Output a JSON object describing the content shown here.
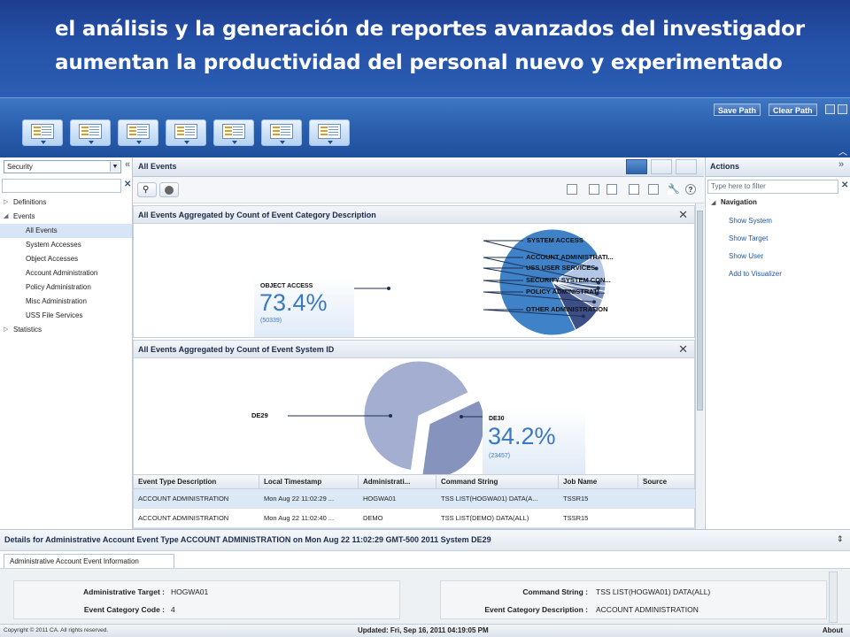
{
  "slide": {
    "line1": "el análisis y la generación de reportes avanzados del investigador",
    "line2": "aumentan la productividad del personal nuevo y experimentado"
  },
  "toolbar": {
    "save_path": "Save Path",
    "clear_path": "Clear Path"
  },
  "left_panel": {
    "select_value": "Security",
    "tree": [
      {
        "label": "Definitions",
        "level": 0,
        "twisty": "collapsed"
      },
      {
        "label": "Events",
        "level": 0,
        "twisty": "expanded"
      },
      {
        "label": "All Events",
        "level": 1,
        "selected": true
      },
      {
        "label": "System Accesses",
        "level": 1
      },
      {
        "label": "Object Accesses",
        "level": 1
      },
      {
        "label": "Account Administration",
        "level": 1
      },
      {
        "label": "Policy Administration",
        "level": 1
      },
      {
        "label": "Misc Administration",
        "level": 1
      },
      {
        "label": "USS File Services",
        "level": 1
      },
      {
        "label": "Statistics",
        "level": 0,
        "twisty": "collapsed"
      }
    ]
  },
  "center": {
    "title": "All Events",
    "chart1": {
      "title": "All Events Aggregated by Count of Event Category Description",
      "callout_name": "OBJECT ACCESS",
      "callout_pct": "73.4%",
      "callout_count": "(50339)"
    },
    "chart2": {
      "title": "All Events Aggregated by Count of Event System ID",
      "label_left": "DE29",
      "callout_name": "DE30",
      "callout_pct": "34.2%",
      "callout_count": "(23457)"
    },
    "table": {
      "columns": [
        "Event Type Description",
        "Local Timestamp",
        "Administrati...",
        "Command String",
        "Job Name",
        "Source"
      ],
      "rows": [
        [
          "ACCOUNT ADMINISTRATION",
          "Mon Aug 22 11:02:29 ...",
          "HOGWA01",
          "TSS LIST(HOGWA01) DATA(A...",
          "TSSR15",
          ""
        ],
        [
          "ACCOUNT ADMINISTRATION",
          "Mon Aug 22 11:02:40 ...",
          "DEMO",
          "TSS LIST(DEMO) DATA(ALL)",
          "TSSR15",
          ""
        ]
      ]
    }
  },
  "chart_data": [
    {
      "type": "pie",
      "title": "All Events Aggregated by Count of Event Category Description",
      "slices": [
        {
          "label": "OBJECT ACCESS",
          "percent": 73.4,
          "count": 50339,
          "color": "#3f82c8"
        },
        {
          "label": "SYSTEM ACCESS",
          "percent": 8.0,
          "color": "#b4c7e6"
        },
        {
          "label": "ACCOUNT ADMINISTRATI...",
          "percent": 2.0,
          "color": "#8aa6cf"
        },
        {
          "label": "USS USER SERVICES",
          "percent": 1.6,
          "color": "#7f9acb"
        },
        {
          "label": "SECURITY SYSTEM CON...",
          "percent": 2.5,
          "color": "#7189ba"
        },
        {
          "label": "POLICY ADMINISTRATI...",
          "percent": 3.5,
          "color": "#9aa8cd"
        },
        {
          "label": "OTHER ADMINISTRATION",
          "percent": 9.0,
          "color": "#3d4f87"
        }
      ]
    },
    {
      "type": "pie",
      "title": "All Events Aggregated by Count of Event System ID",
      "slices": [
        {
          "label": "DE29",
          "percent": 65.8,
          "color": "#a3aed0"
        },
        {
          "label": "DE30",
          "percent": 34.2,
          "count": 23457,
          "color": "#8593bd"
        }
      ]
    }
  ],
  "right_panel": {
    "title": "Actions",
    "filter_placeholder": "Type here to filter",
    "navigation_label": "Navigation",
    "links": [
      "Show System",
      "Show Target",
      "Show User",
      "Add to Visualizer"
    ]
  },
  "details": {
    "title": "Details for Administrative Account Event Type ACCOUNT ADMINISTRATION on Mon Aug 22 11:02:29 GMT-500 2011 System DE29",
    "tab": "Administrative Account Event Information",
    "fields": {
      "admin_target_label": "Administrative Target :",
      "admin_target_value": "HOGWA01",
      "category_code_label": "Event Category Code :",
      "category_code_value": "4",
      "command_label": "Command String :",
      "command_value": "TSS LIST(HOGWA01) DATA(ALL)",
      "category_desc_label": "Event Category Description :",
      "category_desc_value": "ACCOUNT ADMINISTRATION"
    }
  },
  "status": {
    "copyright": "Copyright © 2011 CA. All rights reserved.",
    "updated": "Updated: Fri, Sep 16, 2011 04:19:05 PM",
    "about": "About"
  }
}
